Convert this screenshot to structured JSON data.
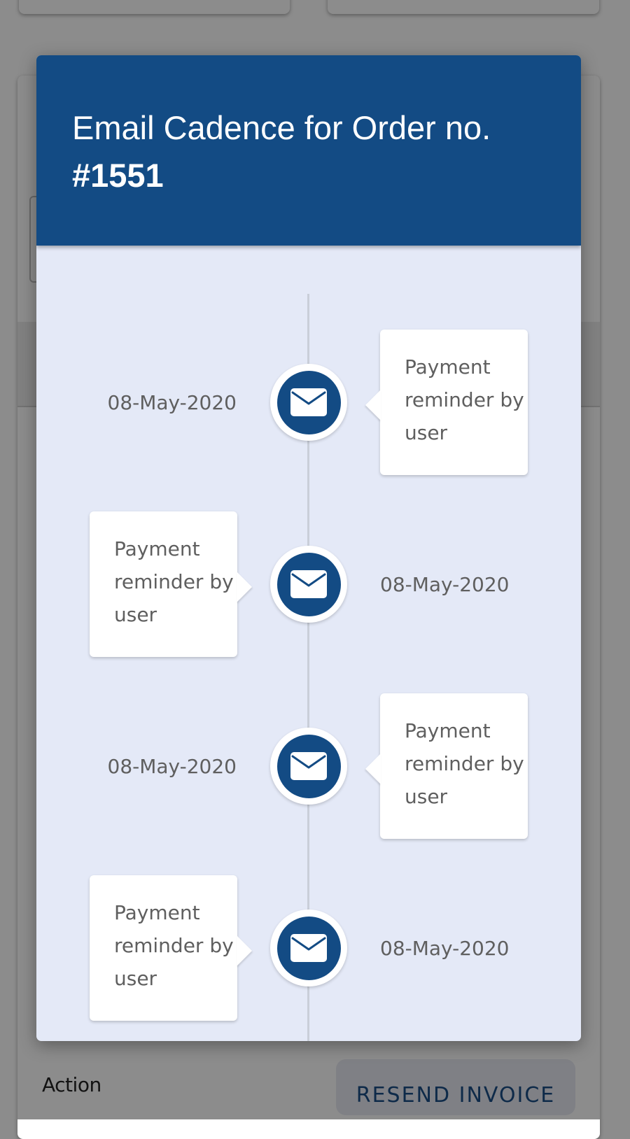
{
  "background_page": {
    "action_label": "Action",
    "resend_button_label": "RESEND INVOICE"
  },
  "modal": {
    "title_prefix": "Email Cadence for Order no.",
    "order_number": "#1551",
    "header_color": "#134b84",
    "body_color": "#e4e9f7",
    "timeline": [
      {
        "date": "08-May-2020",
        "description": "Payment reminder by user",
        "icon": "envelope-icon",
        "card_side": "right"
      },
      {
        "date": "08-May-2020",
        "description": "Payment reminder by user",
        "icon": "envelope-icon",
        "card_side": "left"
      },
      {
        "date": "08-May-2020",
        "description": "Payment reminder by user",
        "icon": "envelope-icon",
        "card_side": "right"
      },
      {
        "date": "08-May-2020",
        "description": "Payment reminder by user",
        "icon": "envelope-icon",
        "card_side": "left"
      }
    ]
  }
}
